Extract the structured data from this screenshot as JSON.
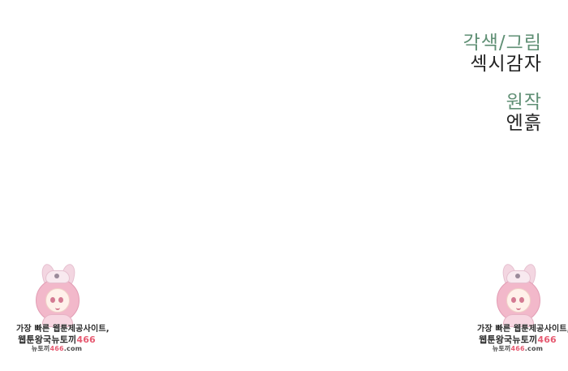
{
  "credits": {
    "role_art": "각색/그림",
    "name_art": "섹시감자",
    "role_original": "원작",
    "name_original": "엔흙"
  },
  "watermark": {
    "line1": "가장 빠른 웹툰제공사이트,",
    "line2_main": "웹툰왕국뉴토끼",
    "line2_accent": "466",
    "line3_main": "뉴토끼",
    "line3_accent": "466",
    "line3_suffix": ".com"
  }
}
